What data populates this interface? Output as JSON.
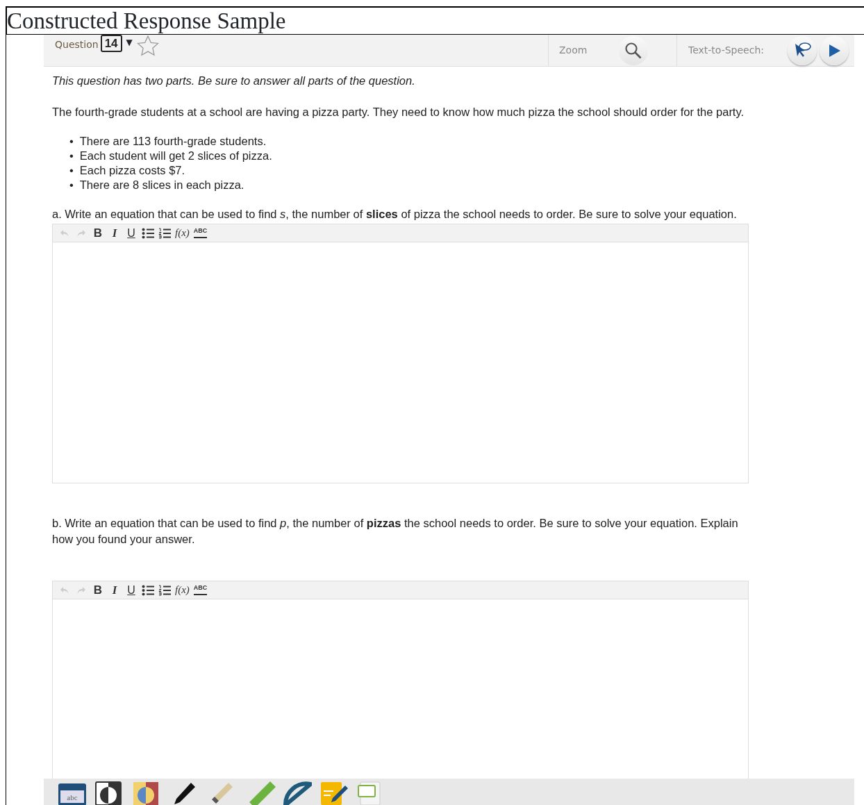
{
  "page_title": "Constructed Response Sample",
  "header": {
    "question_label": "Question",
    "question_number": "14",
    "dropdown_glyph": "▼",
    "zoom_label": "Zoom",
    "tts_label": "Text-to-Speech:"
  },
  "instructions": "This question has two parts. Be sure to answer all parts of the question.",
  "intro": "The fourth-grade students at a school are having a pizza party. They need to know how much pizza the school should order for the party.",
  "facts": [
    {
      "marker": "•",
      "text": "There are 113 fourth-grade students."
    },
    {
      "marker": "•",
      "text": "Each student will get 2 slices of pizza."
    },
    {
      "marker": "•",
      "text": "Each pizza costs $7."
    },
    {
      "marker": "•",
      "text": "There are 8 slices in each pizza."
    }
  ],
  "parts": [
    {
      "prompt": "a. Write an equation that can be used to find *s*, the number of **slices** of pizza the school needs to order. Be sure to solve your equation.",
      "editor_toolbar": [
        {
          "kind": "undo",
          "disabled": true
        },
        {
          "kind": "redo",
          "disabled": true
        },
        {
          "kind": "bold",
          "label": "B"
        },
        {
          "kind": "italic",
          "label": "I"
        },
        {
          "kind": "underline",
          "label": "U"
        },
        {
          "kind": "bullets"
        },
        {
          "kind": "numbers"
        },
        {
          "kind": "formula",
          "label": "f(x)"
        },
        {
          "kind": "spell",
          "label": "ABC"
        }
      ]
    },
    {
      "prompt": "b. Write an equation that can be used to find *p*, the number of **pizzas** the school needs to order. Be sure to solve your equation. Explain how you found your answer.",
      "editor_toolbar": [
        {
          "kind": "undo",
          "disabled": true
        },
        {
          "kind": "redo",
          "disabled": true
        },
        {
          "kind": "bold",
          "label": "B"
        },
        {
          "kind": "italic",
          "label": "I"
        },
        {
          "kind": "underline",
          "label": "U"
        },
        {
          "kind": "bullets"
        },
        {
          "kind": "numbers"
        },
        {
          "kind": "formula",
          "label": "f(x)"
        },
        {
          "kind": "spell",
          "label": "ABC"
        }
      ]
    }
  ],
  "tools": [
    {
      "kind": "keyboard",
      "label": "abc"
    },
    {
      "kind": "contrast"
    },
    {
      "kind": "color"
    },
    {
      "kind": "pen"
    },
    {
      "kind": "highlighter"
    },
    {
      "kind": "ruler"
    },
    {
      "kind": "protractor"
    },
    {
      "kind": "notepad"
    },
    {
      "kind": "masking"
    }
  ]
}
